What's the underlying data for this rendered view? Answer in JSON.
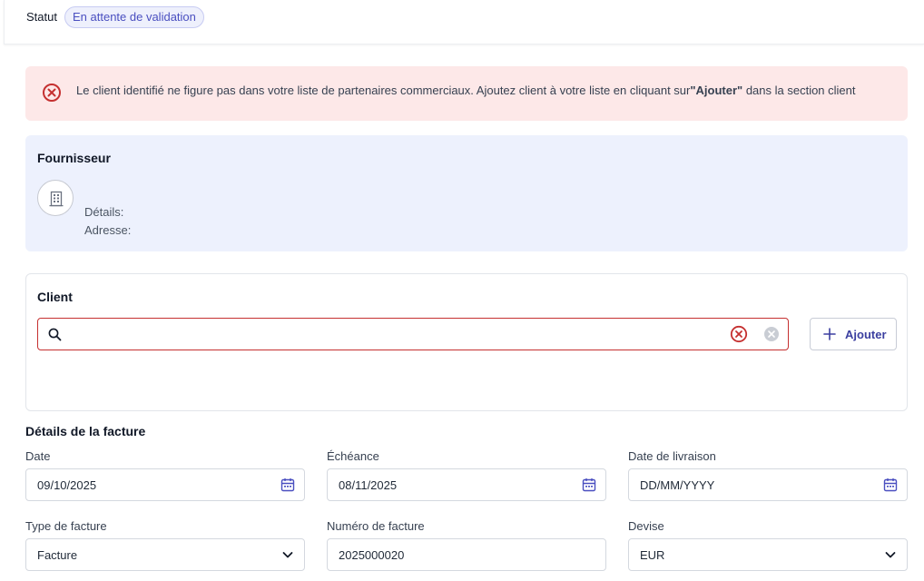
{
  "status": {
    "label": "Statut",
    "badge": "En attente de validation"
  },
  "alert": {
    "text_before": "Le client identifié ne figure pas dans votre liste de partenaires commerciaux. Ajoutez client à votre liste en cliquant sur",
    "text_bold": "\"Ajouter\"",
    "text_after": " dans la section client",
    "icon": "error-circle-icon",
    "color": "#fde8e8"
  },
  "supplier": {
    "title": "Fournisseur",
    "details_label": "Détails:",
    "address_label": "Adresse:",
    "icon": "building-icon",
    "background": "#edf1fd"
  },
  "client": {
    "title": "Client",
    "search": {
      "value": "",
      "placeholder": ""
    },
    "add_label": "Ajouter",
    "error_color": "#c53030"
  },
  "invoice": {
    "title": "Détails de la facture",
    "fields": {
      "date": {
        "label": "Date",
        "value": "09/10/2025",
        "icon": "calendar-icon"
      },
      "due": {
        "label": "Échéance",
        "value": "08/11/2025",
        "icon": "calendar-icon"
      },
      "delivery": {
        "label": "Date de livraison",
        "value": "DD/MM/YYYY",
        "icon": "calendar-icon"
      },
      "type": {
        "label": "Type de facture",
        "value": "Facture",
        "icon": "chevron-down-icon"
      },
      "number": {
        "label": "Numéro de facture",
        "value": "2025000020"
      },
      "currency": {
        "label": "Devise",
        "value": "EUR",
        "icon": "chevron-down-icon"
      }
    }
  },
  "colors": {
    "accent": "#4a4fc0",
    "error": "#c53030"
  }
}
